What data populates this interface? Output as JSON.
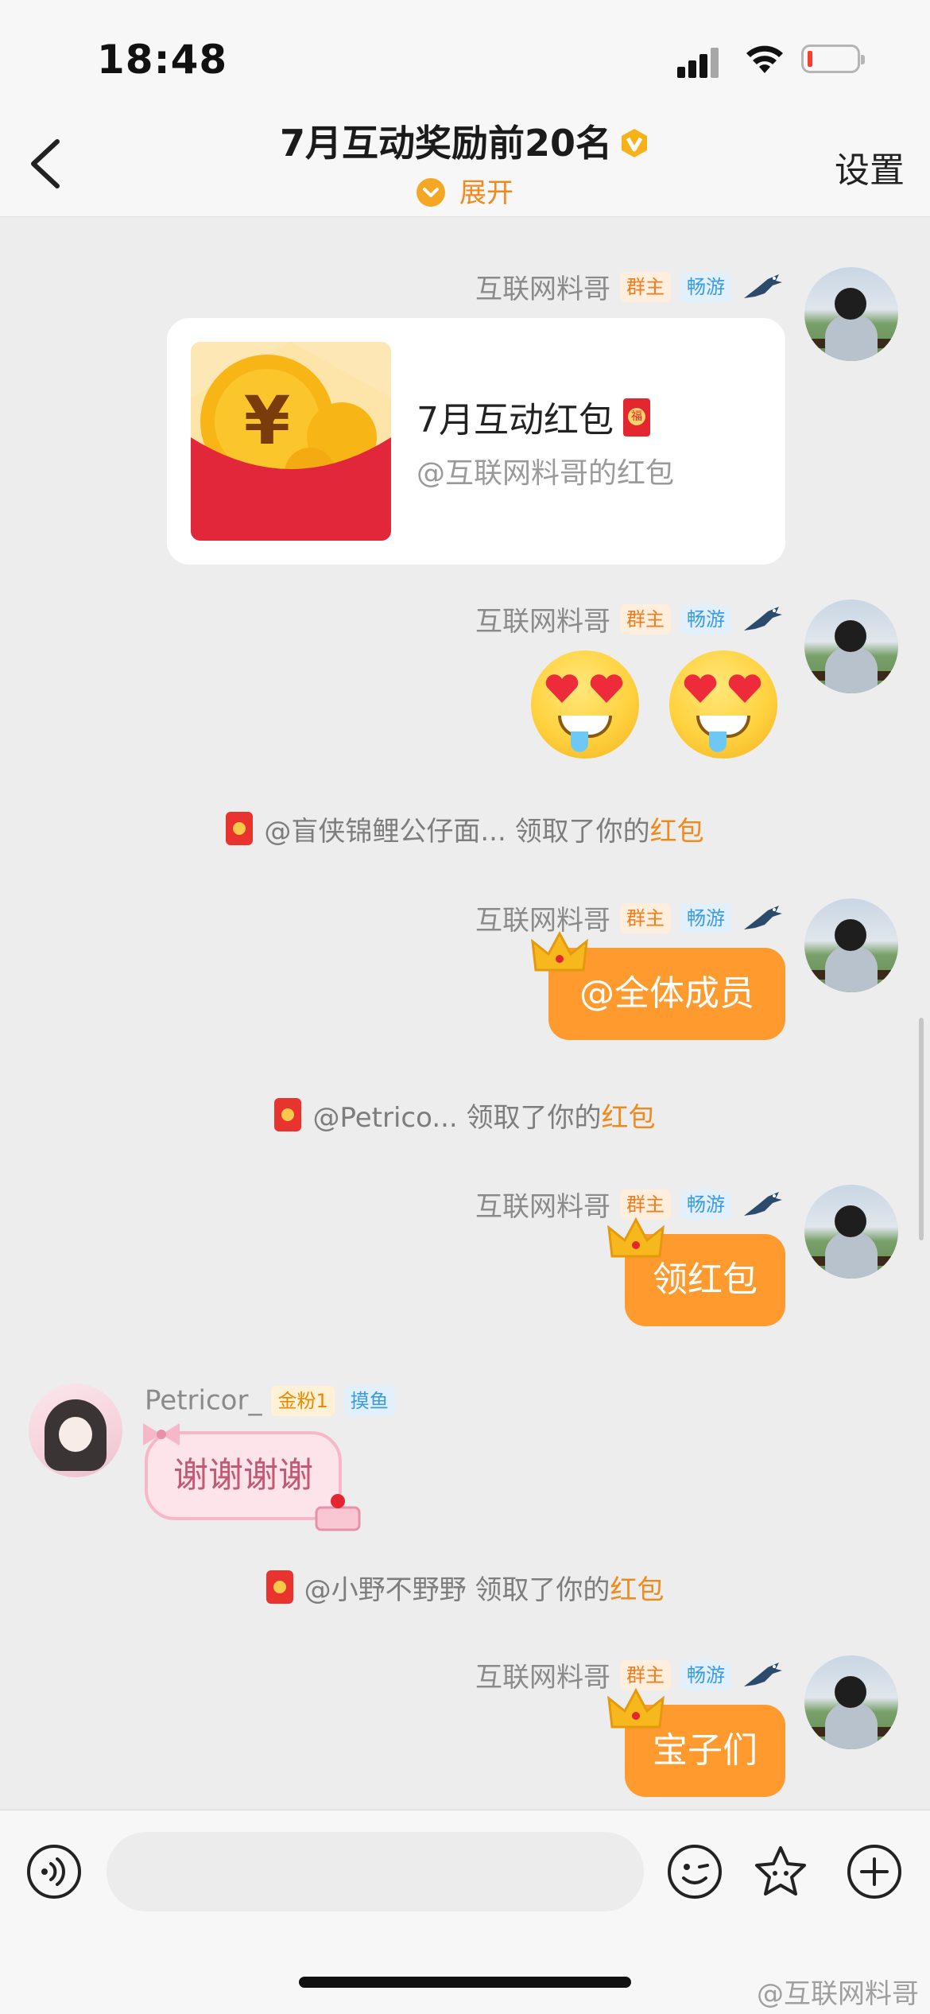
{
  "status_bar": {
    "time": "18:48"
  },
  "header": {
    "title": "7月互动奖励前20名",
    "expand_label": "展开",
    "settings_label": "设置"
  },
  "messages": {
    "m1": {
      "sender": "互联网料哥",
      "badge_owner": "群主",
      "badge_level": "畅游",
      "card_title": "7月互动红包",
      "card_subtitle": "@互联网料哥的红包"
    },
    "m2": {
      "sender": "互联网料哥",
      "badge_owner": "群主",
      "badge_level": "畅游"
    },
    "sys1": {
      "text": "@盲侠锦鲤公仔面... 领取了你的",
      "link": "红包"
    },
    "m3": {
      "sender": "互联网料哥",
      "badge_owner": "群主",
      "badge_level": "畅游",
      "text": "@全体成员"
    },
    "sys2": {
      "text": "@Petrico... 领取了你的",
      "link": "红包"
    },
    "m4": {
      "sender": "互联网料哥",
      "badge_owner": "群主",
      "badge_level": "畅游",
      "text": "领红包"
    },
    "m5": {
      "sender": "Petricor_",
      "badge_fans": "金粉1",
      "badge_level": "摸鱼",
      "text": "谢谢谢谢"
    },
    "sys3": {
      "text": "@小野不野野 领取了你的",
      "link": "红包"
    },
    "m6": {
      "sender": "互联网料哥",
      "badge_owner": "群主",
      "badge_level": "畅游",
      "text": "宝子们"
    }
  },
  "input_bar": {
    "placeholder": ""
  },
  "watermark": "@互联网料哥",
  "colors": {
    "accent": "#fe9a2e",
    "link": "#f18a1b",
    "background": "#ededed",
    "red_packet": "#e3262f"
  },
  "icons": [
    "back-icon",
    "verified-icon",
    "chevron-down-icon",
    "bird-icon",
    "crown-icon",
    "red-packet-icon",
    "voice-icon",
    "emoji-icon",
    "sticker-icon",
    "plus-icon"
  ]
}
